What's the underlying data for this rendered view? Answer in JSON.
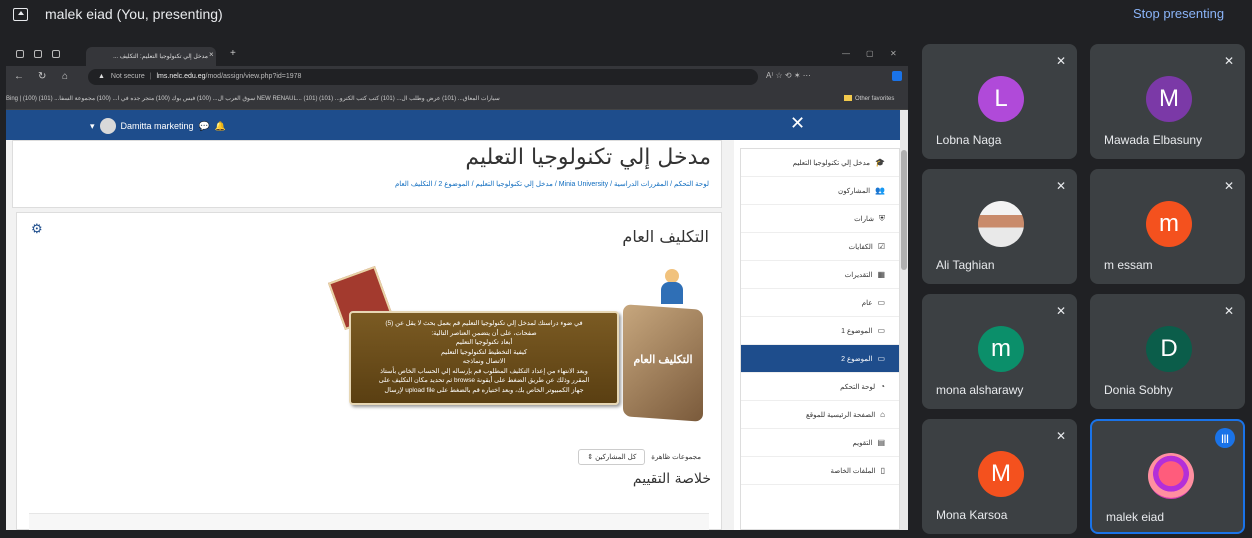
{
  "meet": {
    "presenter_label": "malek eiad (You, presenting)",
    "stop_label": "Stop presenting"
  },
  "browser": {
    "tab_title": "مدخل إلي تكنولوجيا التعليم: التكليف ...",
    "window_controls": [
      "—",
      "▢",
      "✕"
    ],
    "not_secure": "Not secure",
    "url_host": "lms.nelc.edu.eg",
    "url_path": "/mod/assign/view.php?id=1978",
    "bookmarks_text": "Bing   |   (100) سوق العرب ال...   (100) فيس بوك   (100) متجر جده في ا...   (100) مجموعة السفا...   (101) NEW RENAUL...   (101) سيارات المعاق...   (101) عرض وطلب ال...   (101) كتب كتب الكترو...   (101)",
    "bookmarks_other": "Other favorites"
  },
  "moodle": {
    "user_name": "Damitta marketing",
    "course_title": "مدخل إلي تكنولوجيا التعليم",
    "breadcrumb": "لوحة التحكم  /  المقررات الدراسية  /  Minia University  /  مدخل إلي تكنولوجيا التعليم  /  الموضوع 2  /  التكليف العام",
    "assignment_title": "التكليف العام",
    "banner_label": "التكليف العام",
    "banner_lines": [
      "في ضوء دراستك لمدخل إلي تكنولوجيا التعليم قم بعمل بحث لا يقل عن (5)",
      "صفحات، على أن يتضمن العناصر التالية:",
      "أبعاد تكنولوجيا التعليم",
      "كيفية التخطيط لتكنولوجيا التعليم",
      "الاتصال ونماذجه",
      "وبعد الانتهاء من إعداد التكليف المطلوب قم بإرساله إلي الحساب الخاص بأستاذ",
      "المقرر وذلك عن طريق الضغط على أيقونة browse ثم تحديد مكان التكليف على",
      "جهاز الكمبيوتر الخاص بك، وبعد اختياره قم بالضغط على upload file لإرسال"
    ],
    "filter_label": "مجموعات ظاهرة",
    "filter_value": "كل المشاركين",
    "summary_title": "خلاصة التقييم",
    "drawer": [
      {
        "label": "مدخل إلي تكنولوجيا التعليم",
        "icon": "graduation-cap-icon"
      },
      {
        "label": "المشاركون",
        "icon": "users-icon"
      },
      {
        "label": "شارات",
        "icon": "shield-icon"
      },
      {
        "label": "الكفايات",
        "icon": "check-square-icon"
      },
      {
        "label": "التقديرات",
        "icon": "table-icon"
      },
      {
        "label": "عام",
        "icon": "folder-icon"
      },
      {
        "label": "الموضوع 1",
        "icon": "folder-icon"
      },
      {
        "label": "الموضوع 2",
        "icon": "folder-icon"
      },
      {
        "label": "لوحة التحكم",
        "icon": "dashboard-icon"
      },
      {
        "label": "الصفحة الرئيسية للموقع",
        "icon": "home-icon"
      },
      {
        "label": "التقويم",
        "icon": "calendar-icon"
      },
      {
        "label": "الملفات الخاصة",
        "icon": "file-icon"
      }
    ]
  },
  "participants": [
    {
      "name": "Lobna Naga",
      "initial": "L",
      "color": "#b04ad9",
      "muted": true
    },
    {
      "name": "Mawada Elbasuny",
      "initial": "M",
      "color": "#7b39a7",
      "muted": true
    },
    {
      "name": "Ali Taghian",
      "initial": "",
      "color": "#e0e0e0",
      "muted": true
    },
    {
      "name": "m essam",
      "initial": "m",
      "color": "#f4511e",
      "muted": true
    },
    {
      "name": "mona alsharawy",
      "initial": "m",
      "color": "#0b8f6a",
      "muted": true
    },
    {
      "name": "Donia Sobhy",
      "initial": "D",
      "color": "#0b5d4a",
      "muted": true
    },
    {
      "name": "Mona Karsoa",
      "initial": "M",
      "color": "#f4511e",
      "muted": true
    },
    {
      "name": "malek eiad",
      "initial": "",
      "color": "#d73ab2",
      "muted": false
    }
  ]
}
